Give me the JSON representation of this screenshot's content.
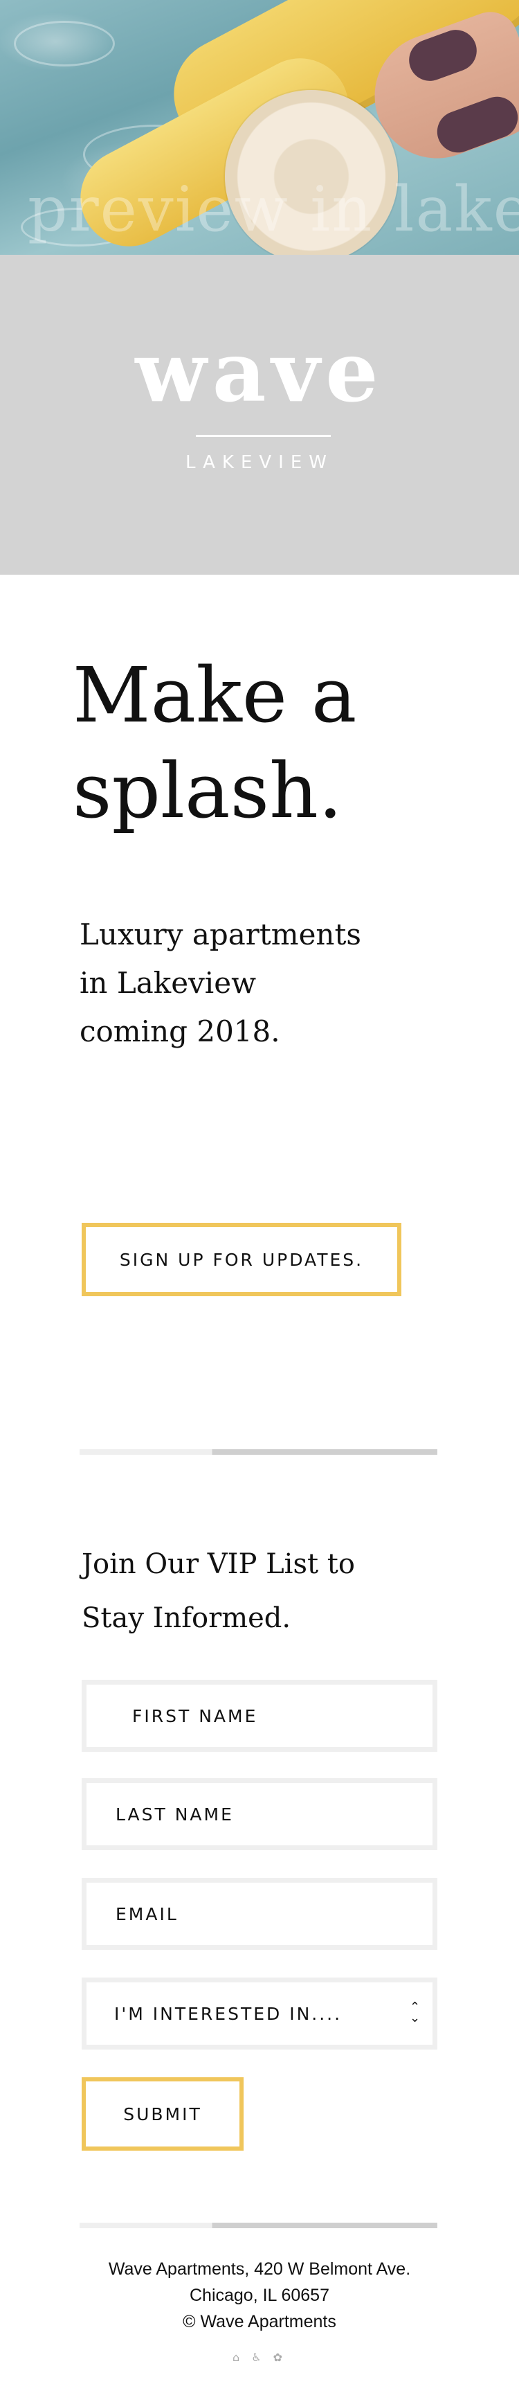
{
  "hero": {
    "watermark_text": "preview in lake"
  },
  "logo": {
    "wordmark": "wave",
    "subtitle": "LAKEVIEW"
  },
  "intro": {
    "headline_line1": "Make a",
    "headline_line2": "splash.",
    "subline_line1": "Luxury apartments",
    "subline_line2": "in Lakeview",
    "subline_line3": "coming 2018.",
    "signup_button": "SIGN UP FOR UPDATES."
  },
  "form": {
    "title_line1": "Join Our VIP List to",
    "title_line2": "Stay Informed.",
    "first_name_placeholder": "FIRST NAME",
    "last_name_placeholder": "LAST NAME",
    "email_placeholder": "EMAIL",
    "interest_selected": "I'M INTERESTED IN....",
    "submit_label": "SUBMIT"
  },
  "footer": {
    "address_line1": "Wave Apartments, 420 W Belmont Ave.",
    "address_line2": "Chicago, IL 60657",
    "copyright": "© Wave Apartments",
    "icons": [
      "equal-housing-icon",
      "accessibility-icon",
      "pet-friendly-icon"
    ]
  },
  "colors": {
    "accent_gold": "#f0c65b",
    "band_gray": "#d3d3d3",
    "field_border": "#efefef"
  }
}
